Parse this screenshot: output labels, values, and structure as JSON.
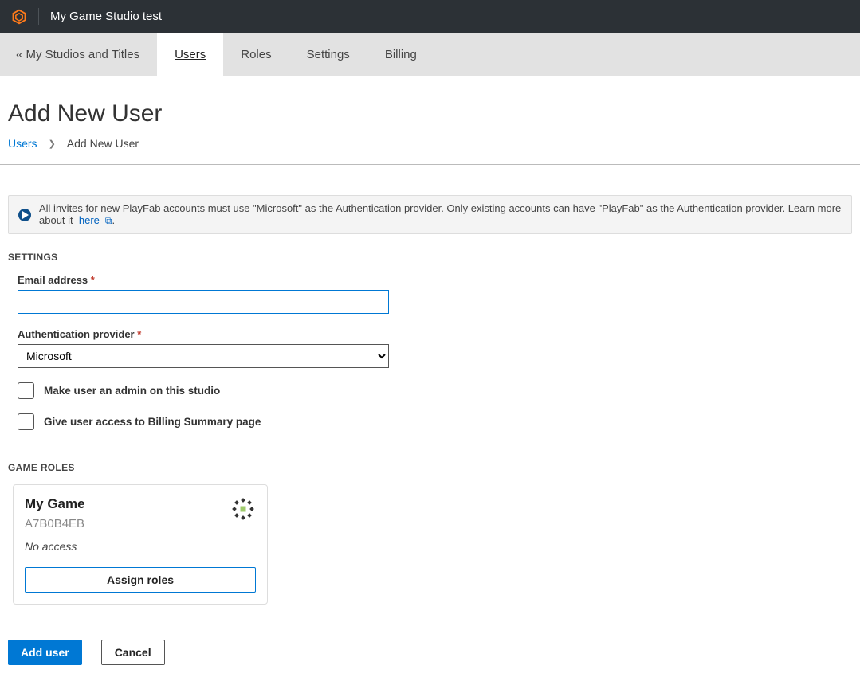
{
  "header": {
    "studio_name": "My Game Studio test"
  },
  "tabs": {
    "back_label": "« My Studios and Titles",
    "items": [
      {
        "label": "Users",
        "active": true
      },
      {
        "label": "Roles",
        "active": false
      },
      {
        "label": "Settings",
        "active": false
      },
      {
        "label": "Billing",
        "active": false
      }
    ]
  },
  "page": {
    "title": "Add New User"
  },
  "breadcrumb": {
    "parent": "Users",
    "current": "Add New User"
  },
  "banner": {
    "text": "All invites for new PlayFab accounts must use \"Microsoft\" as the Authentication provider. Only existing accounts can have \"PlayFab\" as the Authentication provider. Learn more about it",
    "link_label": "here",
    "trailing": "."
  },
  "settings": {
    "section_label": "SETTINGS",
    "email_label": "Email address",
    "email_value": "",
    "auth_label": "Authentication provider",
    "auth_selected": "Microsoft",
    "checkbox_admin": "Make user an admin on this studio",
    "checkbox_billing": "Give user access to Billing Summary page"
  },
  "game_roles": {
    "section_label": "GAME ROLES",
    "game_title": "My Game",
    "game_id": "A7B0B4EB",
    "access_text": "No access",
    "assign_label": "Assign roles"
  },
  "buttons": {
    "add": "Add user",
    "cancel": "Cancel"
  }
}
